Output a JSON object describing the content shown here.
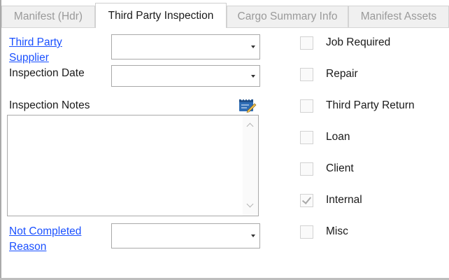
{
  "tabs": [
    {
      "label": "Manifest (Hdr)",
      "active": false
    },
    {
      "label": "Third Party Inspection",
      "active": true
    },
    {
      "label": "Cargo Summary Info",
      "active": false
    },
    {
      "label": "Manifest Assets",
      "active": false
    }
  ],
  "form": {
    "third_party_supplier": {
      "label_line1": "Third Party",
      "label_line2": "Supplier",
      "value": ""
    },
    "inspection_date": {
      "label": "Inspection Date",
      "value": ""
    },
    "inspection_notes": {
      "label": "Inspection Notes",
      "value": ""
    },
    "not_completed_reason": {
      "label_line1": "Not Completed",
      "label_line2": "Reason",
      "value": ""
    }
  },
  "checkboxes": [
    {
      "label": "Job Required",
      "checked": false
    },
    {
      "label": "Repair",
      "checked": false
    },
    {
      "label": "Third Party Return",
      "checked": false
    },
    {
      "label": "Loan",
      "checked": false
    },
    {
      "label": "Client",
      "checked": false
    },
    {
      "label": "Internal",
      "checked": true
    },
    {
      "label": "Misc",
      "checked": false
    }
  ],
  "colors": {
    "link": "#1a50ff",
    "tab_inactive_text": "#9a9a9a",
    "edit_icon": "#2f6db5"
  },
  "icons": {
    "notes_editor": "edit-notes-icon",
    "combo_arrow": "chevron-down-icon"
  }
}
